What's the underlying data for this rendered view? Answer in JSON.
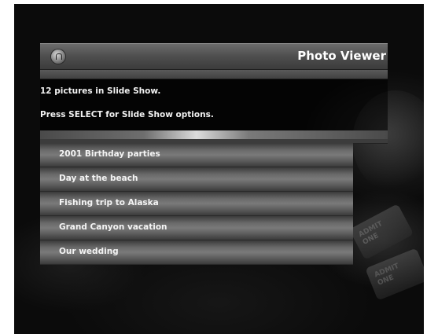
{
  "app": {
    "title": "Photo Viewer",
    "logo_icon": "windows-media-center-logo-icon"
  },
  "status": {
    "count_text": "12 pictures in Slide Show.",
    "hint_text": "Press SELECT for Slide Show options."
  },
  "folders": [
    {
      "label": "2001 Birthday parties"
    },
    {
      "label": "Day at the beach"
    },
    {
      "label": "Fishing trip to Alaska"
    },
    {
      "label": "Grand Canyon vacation"
    },
    {
      "label": "Our wedding"
    }
  ],
  "background": {
    "ticket_text": [
      "ADMIT\nONE",
      "ADMIT\nONE"
    ]
  },
  "colors": {
    "background": "#0b0b0b",
    "bar": "#4f4f4f",
    "text": "#ffffff"
  }
}
